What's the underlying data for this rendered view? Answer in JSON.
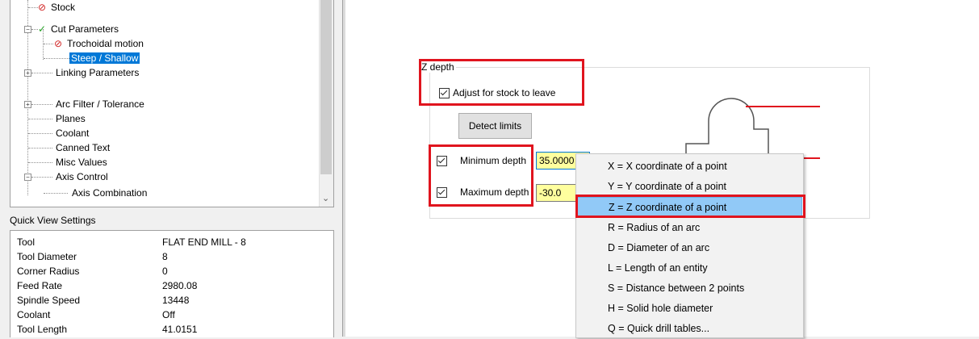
{
  "tree": {
    "items": [
      {
        "label": "Stock",
        "status": "error"
      },
      {
        "label": "Cut Parameters",
        "status": "ok"
      },
      {
        "label": "Trochoidal motion",
        "status": "error"
      },
      {
        "label": "Steep / Shallow",
        "selected": true
      },
      {
        "label": "Linking Parameters"
      },
      {
        "label": "Arc Filter / Tolerance"
      },
      {
        "label": "Planes"
      },
      {
        "label": "Coolant"
      },
      {
        "label": "Canned Text"
      },
      {
        "label": "Misc Values"
      },
      {
        "label": "Axis Control"
      },
      {
        "label": "Axis Combination"
      }
    ]
  },
  "quick_view": {
    "title": "Quick View Settings",
    "rows": [
      {
        "key": "Tool",
        "value": "FLAT END MILL - 8"
      },
      {
        "key": "Tool Diameter",
        "value": "8"
      },
      {
        "key": "Corner Radius",
        "value": "0"
      },
      {
        "key": "Feed Rate",
        "value": "2980.08"
      },
      {
        "key": "Spindle Speed",
        "value": "13448"
      },
      {
        "key": "Coolant",
        "value": "Off"
      },
      {
        "key": "Tool Length",
        "value": "41.0151"
      }
    ]
  },
  "zdepth": {
    "title": "Z depth",
    "adjust_label": "Adjust for stock to leave",
    "detect_label": "Detect limits",
    "min_label": "Minimum depth",
    "min_value": "35.0000",
    "max_label": "Maximum depth",
    "max_value": "-30.0"
  },
  "menu": {
    "items": [
      "X = X coordinate of a point",
      "Y = Y coordinate of a point",
      "Z = Z coordinate of a point",
      "R = Radius of an arc",
      "D = Diameter of an arc",
      "L = Length of an entity",
      "S = Distance between 2 points",
      "H = Solid hole diameter",
      "Q = Quick drill tables..."
    ],
    "highlighted_index": 2
  },
  "colors": {
    "annotation_red": "#e0141e",
    "selection_blue": "#0078d7",
    "highlight": "#91c9f7"
  }
}
